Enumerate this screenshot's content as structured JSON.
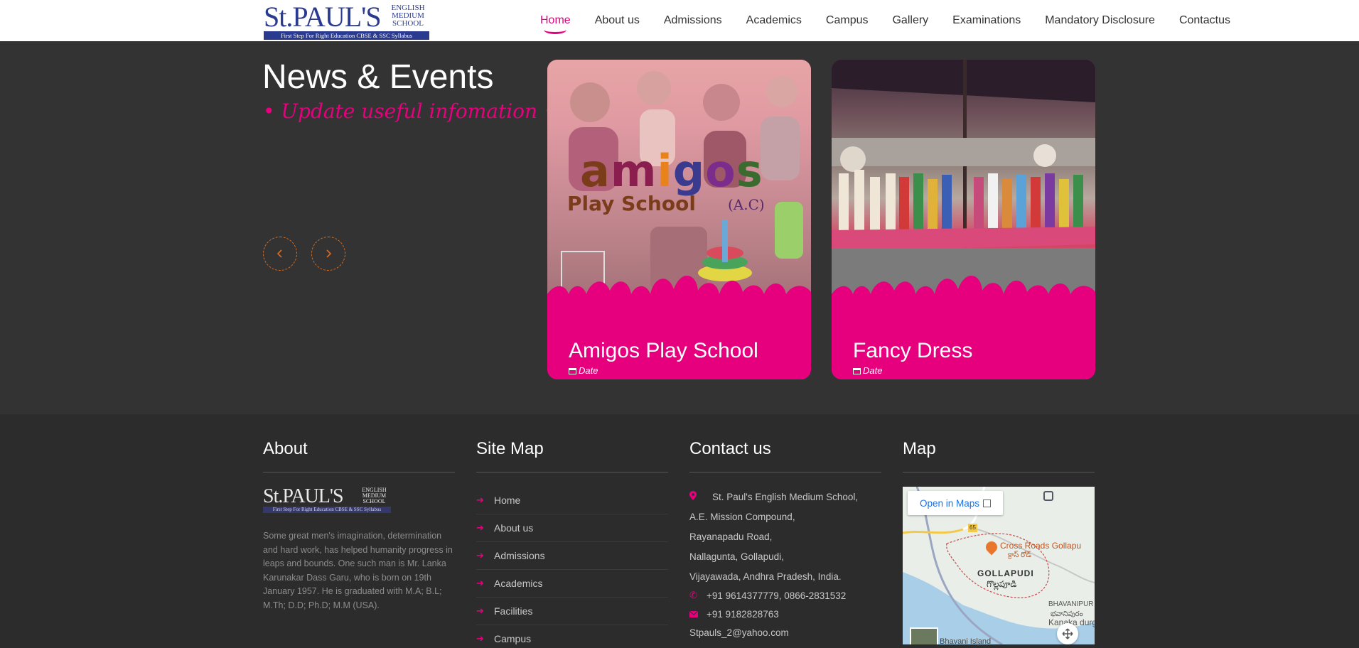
{
  "brand": {
    "name_main": "St.PAUL'S",
    "name_side": [
      "ENGLISH",
      "MEDIUM",
      "SCHOOL"
    ],
    "tagline": "First Step For Right Education CBSE & SSC Syllabus",
    "accent_color": "#e6007e",
    "brand_blue": "#2a3a8f"
  },
  "nav": {
    "items": [
      {
        "label": "Home",
        "active": true
      },
      {
        "label": "About us"
      },
      {
        "label": "Admissions"
      },
      {
        "label": "Academics"
      },
      {
        "label": "Campus"
      },
      {
        "label": "Gallery"
      },
      {
        "label": "Examinations"
      },
      {
        "label": "Mandatory Disclosure"
      },
      {
        "label": "Contactus"
      }
    ]
  },
  "news": {
    "title": "News & Events",
    "subtitle": "• Update useful infomation •",
    "prev_icon": "chevron-left-icon",
    "next_icon": "chevron-right-icon",
    "cards": [
      {
        "title": "Amigos Play School",
        "date_label": "Date",
        "image_logo": {
          "word": "amigos",
          "line2": "Play School",
          "suffix": "(A.C)"
        }
      },
      {
        "title": "Fancy Dress",
        "date_label": "Date"
      }
    ]
  },
  "footer": {
    "about": {
      "heading": "About",
      "text": "Some great men's imagination, determination and hard work, has helped humanity progress in leaps and bounds. One such man is Mr. Lanka Karunakar Dass Garu, who is born on 19th January 1957. He is graduated with M.A; B.L; M.Th; D.D; Ph.D; M.M (USA)."
    },
    "sitemap": {
      "heading": "Site Map",
      "items": [
        "Home",
        "About us",
        "Admissions",
        "Academics",
        "Facilities",
        "Campus"
      ]
    },
    "contact": {
      "heading": "Contact us",
      "address": [
        "St. Paul's English Medium School,",
        "A.E. Mission Compound,",
        "Rayanapadu Road,",
        "Nallagunta, Gollapudi,",
        "Vijayawada, Andhra Pradesh, India."
      ],
      "phone": "+91 9614377779, 0866-2831532",
      "mobile": "+91 9182828763",
      "email": "Stpauls_2@yahoo.com"
    },
    "map": {
      "heading": "Map",
      "open_label": "Open in Maps",
      "labels": {
        "cross_roads": "Cross Roads Gollapu",
        "cross_roads_te": "క్రాస్ రోడ్",
        "gollapudi": "GOLLAPUDI",
        "gollapudi_te": "గొల్లపూడి",
        "bhavanipur": "BHAVANIPUR",
        "bhavanipur_te": "భవానిపురం",
        "kanaka": "Kanaka durga tem",
        "island": "Bhavani Island",
        "highway": "65"
      }
    }
  }
}
